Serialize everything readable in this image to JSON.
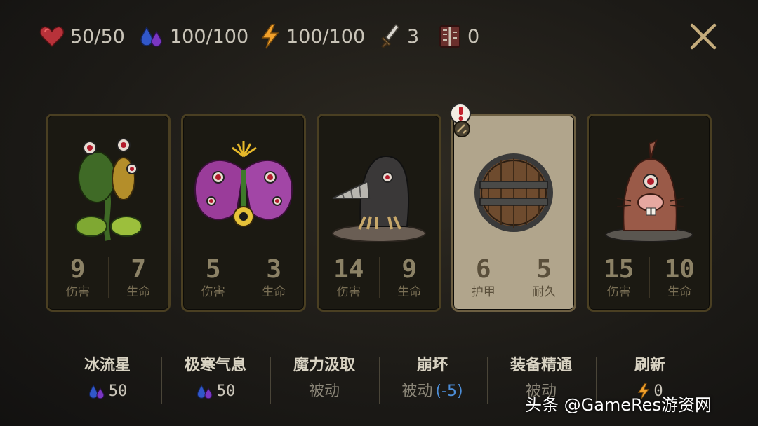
{
  "status_bar": {
    "health": "50/50",
    "mana": "100/100",
    "energy": "100/100",
    "attack": "3",
    "armor": "0"
  },
  "cards": [
    {
      "name": "venus-flytrap",
      "stat1_value": "9",
      "stat1_label": "伤害",
      "stat2_value": "7",
      "stat2_label": "生命",
      "selected": false
    },
    {
      "name": "eye-flower",
      "stat1_value": "5",
      "stat1_label": "伤害",
      "stat2_value": "3",
      "stat2_label": "生命",
      "selected": false
    },
    {
      "name": "drill-mole",
      "stat1_value": "14",
      "stat1_label": "伤害",
      "stat2_value": "9",
      "stat2_label": "生命",
      "selected": false
    },
    {
      "name": "wooden-shield",
      "stat1_value": "6",
      "stat1_label": "护甲",
      "stat2_value": "5",
      "stat2_label": "耐久",
      "selected": true
    },
    {
      "name": "cyclops-mole",
      "stat1_value": "15",
      "stat1_label": "伤害",
      "stat2_value": "10",
      "stat2_label": "生命",
      "selected": false
    }
  ],
  "skills": [
    {
      "name": "冰流星",
      "cost": "50",
      "cost_type": "mana"
    },
    {
      "name": "极寒气息",
      "cost": "50",
      "cost_type": "mana"
    },
    {
      "name": "魔力汲取",
      "passive": "被动"
    },
    {
      "name": "崩坏",
      "passive": "被动",
      "modifier": "(-5)"
    },
    {
      "name": "装备精通",
      "passive": "被动"
    },
    {
      "name": "刷新",
      "cost": "0",
      "cost_type": "energy"
    }
  ],
  "watermark": "头条 @GameRes游资网",
  "colors": {
    "accent": "#c9b48a",
    "modifier": "#4d8ed8",
    "card_border": "#4a3f22",
    "selected_card": "#b1a58c"
  }
}
